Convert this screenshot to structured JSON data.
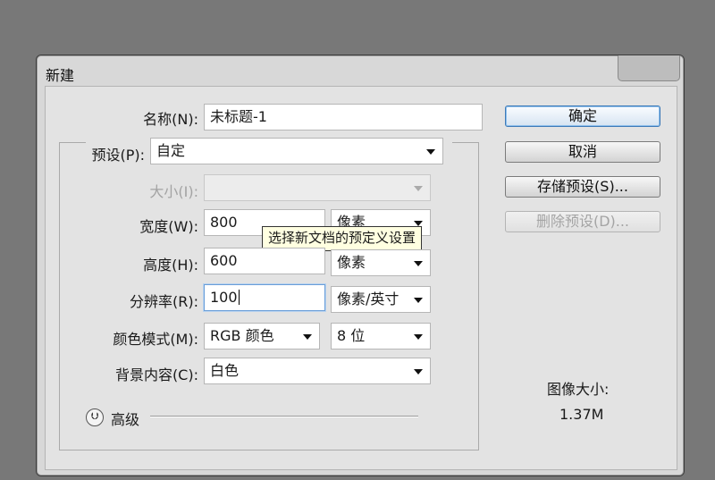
{
  "dialog": {
    "title": "新建",
    "name": {
      "label": "名称(N):",
      "value": "未标题-1"
    },
    "preset": {
      "label": "预设(P):",
      "value": "自定"
    },
    "size": {
      "label": "大小(I):",
      "value": ""
    },
    "width": {
      "label": "宽度(W):",
      "value": "800",
      "unit": "像素"
    },
    "height": {
      "label": "高度(H):",
      "value": "600",
      "unit": "像素"
    },
    "resolution": {
      "label": "分辨率(R):",
      "value": "100",
      "unit": "像素/英寸"
    },
    "color_mode": {
      "label": "颜色模式(M):",
      "mode": "RGB 颜色",
      "depth": "8 位"
    },
    "background": {
      "label": "背景内容(C):",
      "value": "白色"
    },
    "advanced_label": "高级",
    "tooltip": "选择新文档的预定义设置",
    "image_size_label": "图像大小:",
    "image_size_value": "1.37M"
  },
  "buttons": {
    "ok": "确定",
    "cancel": "取消",
    "save_preset": "存储预设(S)...",
    "delete_preset": "删除预设(D)..."
  },
  "icons": {
    "advanced_toggle": "chevron-double-down-icon",
    "dropdown": "triangle-down-icon"
  },
  "colors": {
    "background": "#787878",
    "dialog": "#e3e3e3",
    "tooltip": "#ffffe1",
    "default_button_border": "#3d7ab8"
  }
}
